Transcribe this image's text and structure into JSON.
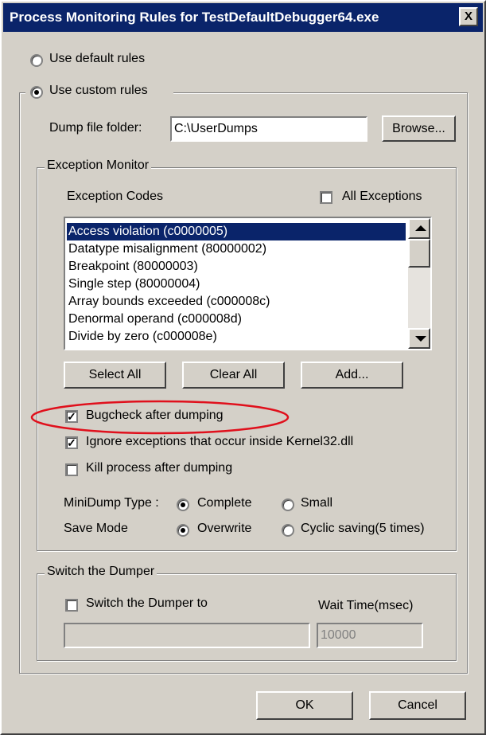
{
  "window": {
    "title": "Process Monitoring Rules for TestDefaultDebugger64.exe",
    "close_label": "X"
  },
  "rules": {
    "default_label": "Use default rules",
    "custom_label": "Use custom rules",
    "selected": "custom"
  },
  "dump": {
    "label": "Dump file folder:",
    "value": "C:\\UserDumps",
    "browse_label": "Browse..."
  },
  "exception_monitor": {
    "title": "Exception Monitor",
    "codes_label": "Exception Codes",
    "all_exceptions_label": "All Exceptions",
    "all_exceptions_checked": false,
    "codes": [
      "Access violation (c0000005)",
      "Datatype misalignment (80000002)",
      "Breakpoint (80000003)",
      "Single step (80000004)",
      "Array bounds exceeded (c000008c)",
      "Denormal operand (c000008d)",
      "Divide by zero (c000008e)"
    ],
    "selected_code": "Access violation (c0000005)",
    "select_all_label": "Select All",
    "clear_all_label": "Clear All",
    "add_label": "Add...",
    "bugcheck_label": "Bugcheck after dumping",
    "bugcheck_checked": true,
    "ignore_kernel32_label": "Ignore exceptions that occur inside Kernel32.dll",
    "ignore_kernel32_checked": true,
    "kill_process_label": "Kill process after dumping",
    "kill_process_checked": false,
    "minidump_label": "MiniDump Type :",
    "minidump_complete": "Complete",
    "minidump_small": "Small",
    "minidump_selected": "Complete",
    "save_mode_label": "Save Mode",
    "save_overwrite": "Overwrite",
    "save_cyclic": "Cyclic saving(5 times)",
    "save_selected": "Overwrite"
  },
  "switch_dumper": {
    "title": "Switch the Dumper",
    "checkbox_label": "Switch the Dumper to",
    "checked": false,
    "path_value": "",
    "wait_label": "Wait Time(msec)",
    "wait_value": "10000"
  },
  "footer": {
    "ok_label": "OK",
    "cancel_label": "Cancel"
  },
  "annotation": {
    "color": "#e0101c"
  }
}
